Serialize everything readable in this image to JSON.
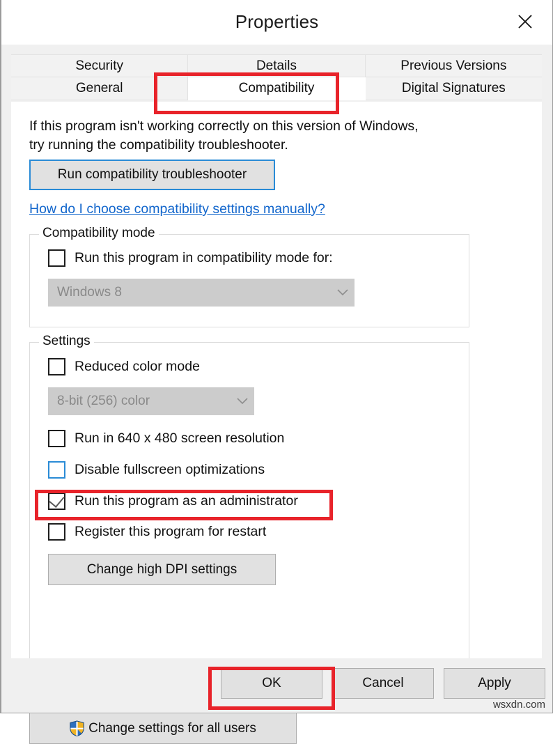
{
  "window": {
    "title": "Properties",
    "close_icon": "close-icon"
  },
  "tabs": {
    "top_row": [
      {
        "label": "Security",
        "selected": false
      },
      {
        "label": "Details",
        "selected": false
      },
      {
        "label": "Previous Versions",
        "selected": false
      }
    ],
    "bottom_row": [
      {
        "label": "General",
        "selected": false
      },
      {
        "label": "Compatibility",
        "selected": true
      },
      {
        "label": "Digital Signatures",
        "selected": false
      }
    ]
  },
  "content": {
    "intro_line1": "If this program isn't working correctly on this version of Windows,",
    "intro_line2": "try running the compatibility troubleshooter.",
    "troubleshooter_button": "Run compatibility troubleshooter",
    "help_link": "How do I choose compatibility settings manually?",
    "compatibility_mode": {
      "legend": "Compatibility mode",
      "checkbox_label": "Run this program in compatibility mode for:",
      "checkbox_checked": false,
      "dropdown_value": "Windows 8",
      "dropdown_disabled": true,
      "dropdown_icon": "chevron-down-icon"
    },
    "settings": {
      "legend": "Settings",
      "reduced_color_label": "Reduced color mode",
      "reduced_color_checked": false,
      "color_depth_value": "8-bit (256) color",
      "color_depth_disabled": true,
      "color_depth_icon": "chevron-down-icon",
      "checkboxes": [
        {
          "label": "Run in 640 x 480 screen resolution",
          "checked": false,
          "highlighted": false
        },
        {
          "label": "Disable fullscreen optimizations",
          "checked": false,
          "highlighted": true
        },
        {
          "label": "Run this program as an administrator",
          "checked": true,
          "highlighted": false
        },
        {
          "label": "Register this program for restart",
          "checked": false,
          "highlighted": false
        }
      ],
      "dpi_button": "Change high DPI settings"
    },
    "all_users_button": "Change settings for all users",
    "all_users_icon": "uac-shield-icon"
  },
  "footer": {
    "ok": "OK",
    "cancel": "Cancel",
    "apply": "Apply"
  },
  "watermark": "wsxdn.com",
  "colors": {
    "annotation_red": "#e8232a",
    "link_blue": "#1266cc",
    "focus_blue": "#2a8bd6",
    "button_face": "#e1e1e1",
    "disabled_combo": "#cccccc",
    "shield_blue": "#2d6fbd",
    "shield_yellow": "#f0b323"
  }
}
